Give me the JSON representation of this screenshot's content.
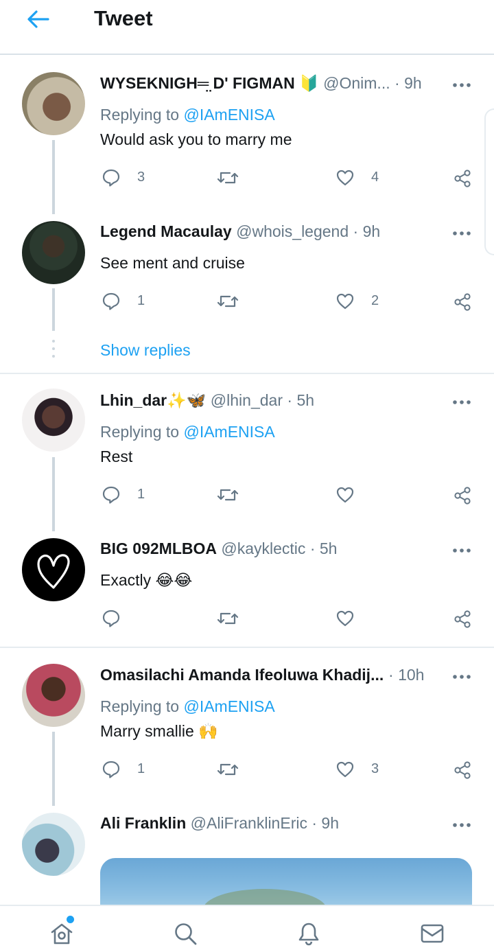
{
  "header": {
    "title": "Tweet"
  },
  "tweets": [
    {
      "name": "WYSEKNIGH═̤ D' FIGMAN 🔰",
      "handle": "@Onim...",
      "sep": "·",
      "time": "9h",
      "replying_prefix": "Replying to",
      "replying_to": "@IAmENISA",
      "text": "Would ask you to marry me",
      "replies": "3",
      "retweets": "",
      "likes": "4"
    },
    {
      "name": "Legend Macaulay",
      "handle": "@whois_legend",
      "sep": "·",
      "time": "9h",
      "text": "See ment and cruise",
      "replies": "1",
      "retweets": "",
      "likes": "2",
      "show_replies": "Show replies"
    },
    {
      "name": "Lhin_dar✨🦋",
      "handle": "@lhin_dar",
      "sep": "·",
      "time": "5h",
      "replying_prefix": "Replying to",
      "replying_to": "@IAmENISA",
      "text": "Rest",
      "replies": "1",
      "retweets": "",
      "likes": ""
    },
    {
      "name": "BIG 092MLBOA",
      "handle": "@kayklectic",
      "sep": "·",
      "time": "5h",
      "text": "Exactly 😂😂",
      "replies": "",
      "retweets": "",
      "likes": ""
    },
    {
      "name": "Omasilachi Amanda Ifeoluwa Khadij...",
      "handle": "",
      "sep": "·",
      "time": "10h",
      "replying_prefix": "Replying to",
      "replying_to": "@IAmENISA",
      "text": "Marry smallie 🙌",
      "replies": "1",
      "retweets": "",
      "likes": "3"
    },
    {
      "name": "Ali Franklin",
      "handle": "@AliFranklinEric",
      "sep": "·",
      "time": "9h"
    }
  ],
  "icons": {
    "back": "arrow-left-icon",
    "more": "more-horizontal-icon",
    "reply": "comment-icon",
    "retweet": "retweet-icon",
    "like": "heart-icon",
    "share": "share-icon",
    "nav_home": "home-icon",
    "nav_search": "search-icon",
    "nav_notifications": "bell-icon",
    "nav_messages": "mail-icon"
  },
  "colors": {
    "accent": "#1da1f2",
    "secondary_text": "#657786",
    "thread_line": "#ccd6dd",
    "divider": "#e6ecf0"
  }
}
